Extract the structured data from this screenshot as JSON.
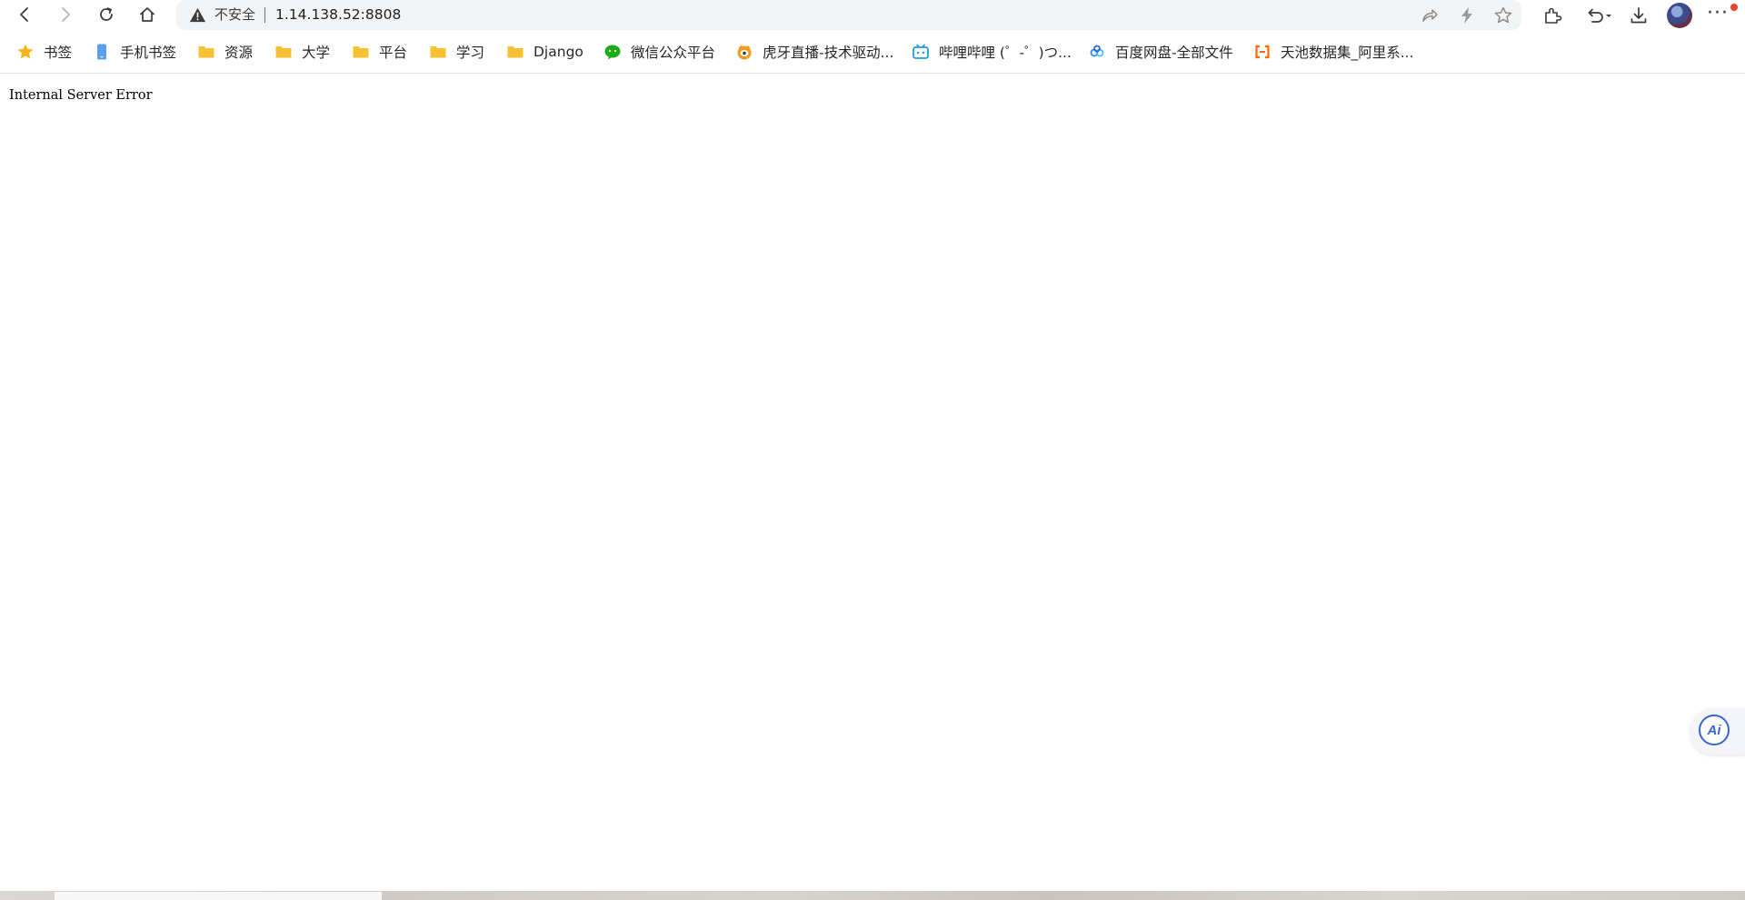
{
  "browser": {
    "security_label": "不安全",
    "url": "1.14.138.52:8808",
    "nav_icons": [
      "back-icon",
      "forward-icon",
      "reload-icon",
      "home-icon"
    ],
    "omnibox_action_icons": [
      "share-icon",
      "lightning-icon",
      "star-icon"
    ],
    "right_icons": [
      "extensions-icon",
      "undo-dropdown-icon",
      "download-icon",
      "profile-avatar",
      "more-icon"
    ],
    "more_label": "···"
  },
  "bookmarks": [
    {
      "label": "书签",
      "icon": "star-icon"
    },
    {
      "label": "手机书签",
      "icon": "phone-icon"
    },
    {
      "label": "资源",
      "icon": "folder-icon"
    },
    {
      "label": "大学",
      "icon": "folder-icon"
    },
    {
      "label": "平台",
      "icon": "folder-icon"
    },
    {
      "label": "学习",
      "icon": "folder-icon"
    },
    {
      "label": "Django",
      "icon": "folder-icon"
    },
    {
      "label": "微信公众平台",
      "icon": "wechat-icon"
    },
    {
      "label": "虎牙直播-技术驱动...",
      "icon": "huya-icon"
    },
    {
      "label": "哔哩哔哩 (゜-゜)つ...",
      "icon": "bilibili-icon"
    },
    {
      "label": "百度网盘-全部文件",
      "icon": "baidu-netdisk-icon"
    },
    {
      "label": "天池数据集_阿里系...",
      "icon": "aliyun-icon"
    }
  ],
  "content": {
    "error_message": "Internal Server Error"
  },
  "ai_assistant": {
    "label": "Ai",
    "color": "#3b63d9"
  },
  "colors": {
    "folder": "#f7c134",
    "accent": "#3b63d9",
    "notification": "#e8432e"
  }
}
